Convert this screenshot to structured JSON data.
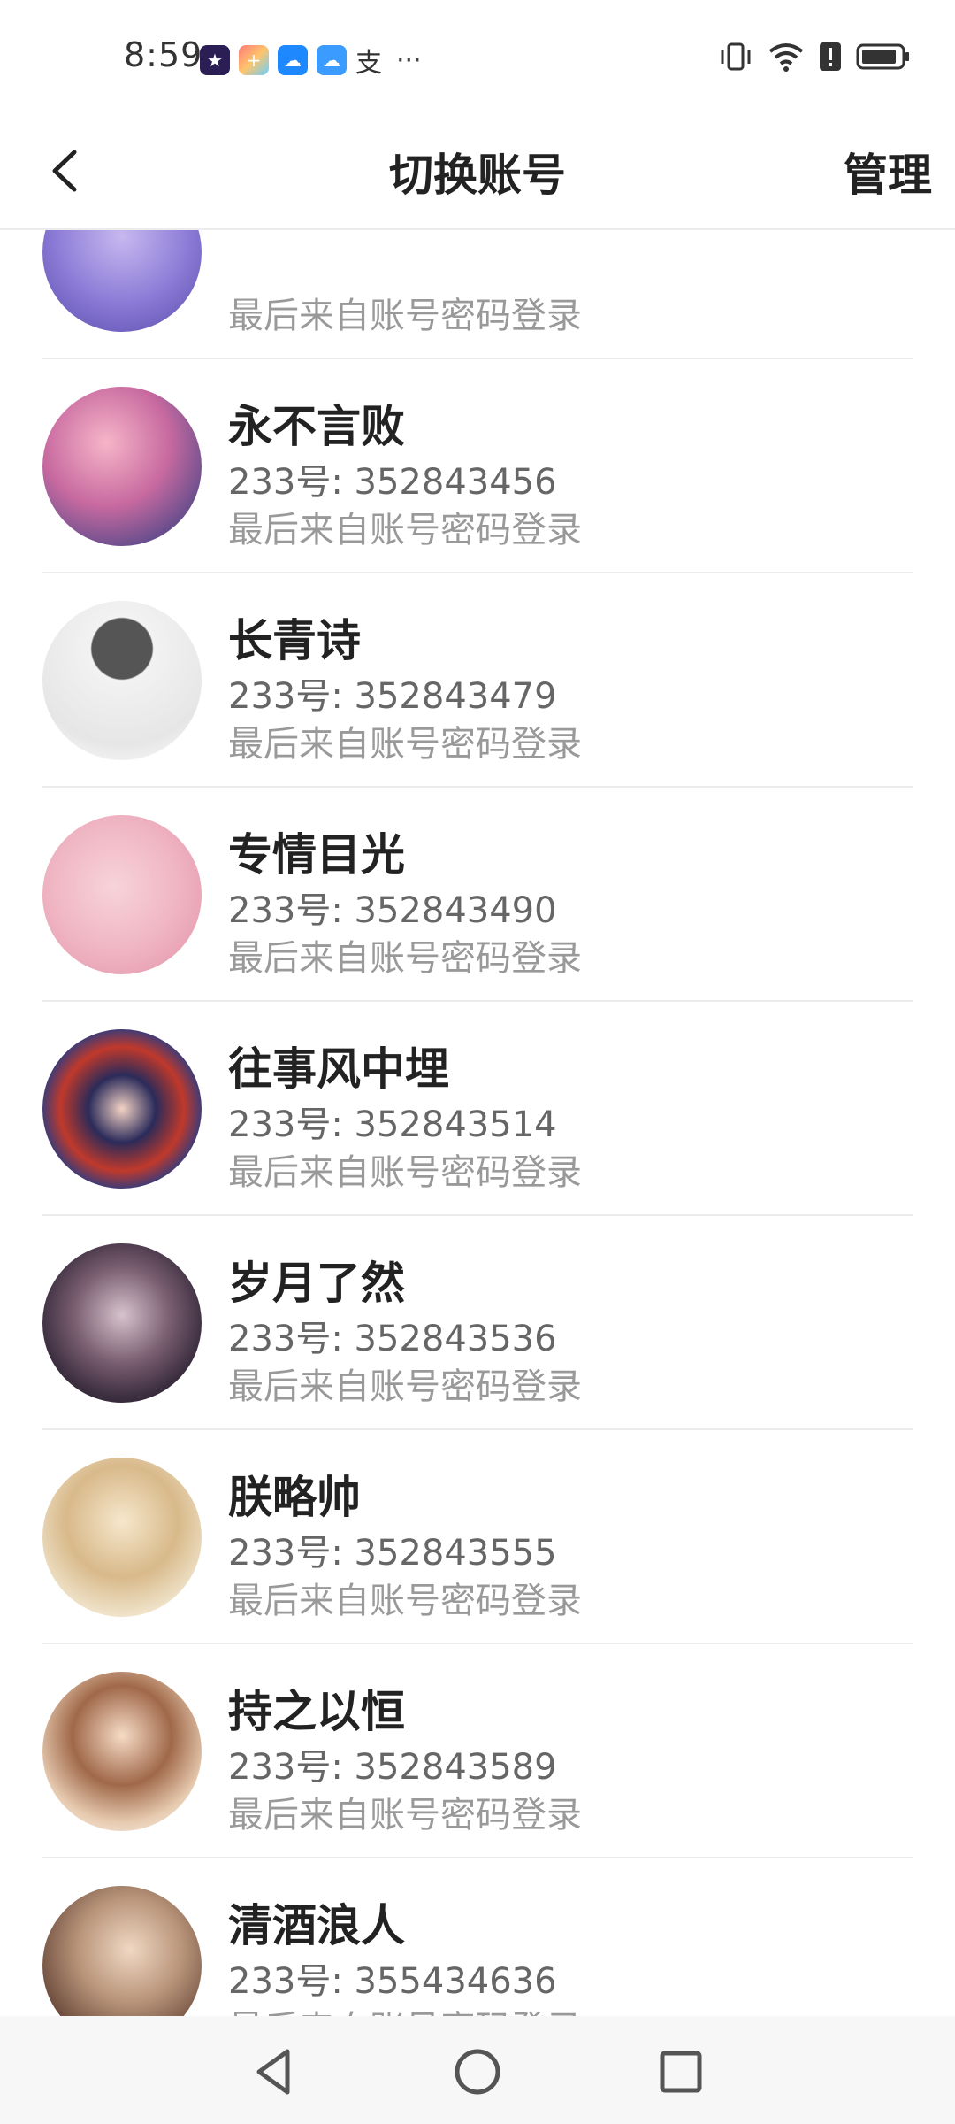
{
  "status_bar": {
    "time": "8:59",
    "app_icons": [
      "game-app-icon",
      "launcher-app-icon",
      "weather-app-icon",
      "cloud-app-icon",
      "alipay-icon"
    ],
    "more": "···"
  },
  "header": {
    "title": "切换账号",
    "manage_label": "管理"
  },
  "accounts": [
    {
      "name": "",
      "uid": "",
      "last_login": "最后来自账号密码登录",
      "avatar": "avatar-icon"
    },
    {
      "name": "永不言败",
      "uid": "233号: 352843456",
      "last_login": "最后来自账号密码登录",
      "avatar": "avatar-icon"
    },
    {
      "name": "长青诗",
      "uid": "233号: 352843479",
      "last_login": "最后来自账号密码登录",
      "avatar": "avatar-icon"
    },
    {
      "name": "专情目光",
      "uid": "233号: 352843490",
      "last_login": "最后来自账号密码登录",
      "avatar": "avatar-icon"
    },
    {
      "name": "往事风中埋",
      "uid": "233号: 352843514",
      "last_login": "最后来自账号密码登录",
      "avatar": "avatar-icon"
    },
    {
      "name": "岁月了然",
      "uid": "233号: 352843536",
      "last_login": "最后来自账号密码登录",
      "avatar": "avatar-icon"
    },
    {
      "name": "朕略帅",
      "uid": "233号: 352843555",
      "last_login": "最后来自账号密码登录",
      "avatar": "avatar-icon"
    },
    {
      "name": "持之以恒",
      "uid": "233号: 352843589",
      "last_login": "最后来自账号密码登录",
      "avatar": "avatar-icon"
    },
    {
      "name": "清酒浪人",
      "uid": "233号: 355434636",
      "last_login": "最后来自账号密码登录",
      "avatar": "avatar-icon"
    }
  ],
  "nav_bar": {
    "icons": [
      "back-triangle-icon",
      "home-circle-icon",
      "recents-square-icon"
    ]
  },
  "colors": {
    "avatars": [
      "#8a7ad6",
      "#b07cc8",
      "#d8d8d8",
      "#f4c9d2",
      "#c0392b",
      "#3b2e3f",
      "#efe2c8",
      "#e7cbb0",
      "#a89583"
    ]
  }
}
